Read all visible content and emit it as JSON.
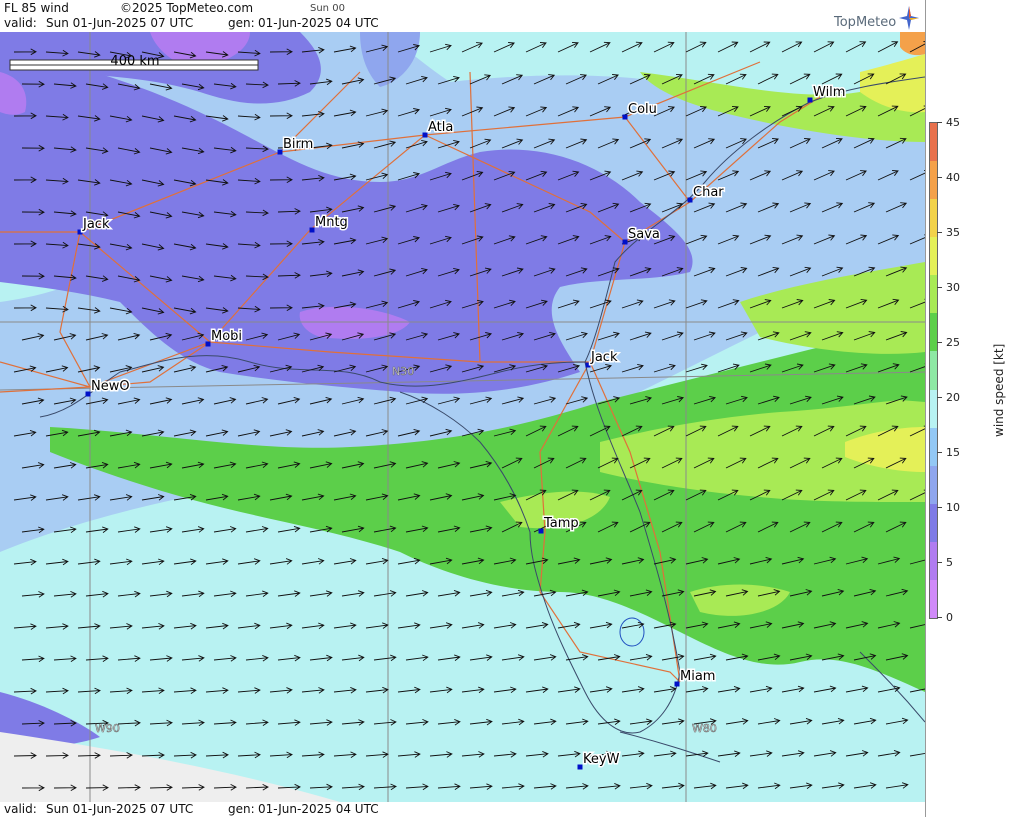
{
  "header": {
    "title": "FL 85 wind",
    "copyright": "©2025 TopMeteo.com",
    "run": "Sun 00",
    "valid_label": "valid:",
    "valid_value": "Sun  01-Jun-2025  07 UTC",
    "gen_label": "gen:",
    "gen_value": "01-Jun-2025 04 UTC"
  },
  "logo": {
    "text": "TopMeteo",
    "icon": "compass-star-icon"
  },
  "footer": {
    "valid_label": "valid:",
    "valid_value": "Sun  01-Jun-2025  07 UTC",
    "gen_label": "gen:",
    "gen_value": "01-Jun-2025 04 UTC"
  },
  "scale_bar": {
    "label": "400 km"
  },
  "grid_labels": {
    "lat_n30": "N30",
    "lon_w90": "W90",
    "lon_w80": "W80"
  },
  "colorbar": {
    "unit_label": "wind speed [kt]",
    "ticks": [
      "45",
      "40",
      "35",
      "30",
      "25",
      "20",
      "15",
      "10",
      "5",
      "0"
    ],
    "colors": [
      "#e8714d",
      "#f4a14a",
      "#f2d24a",
      "#e4f058",
      "#a8ea55",
      "#5ccf4a",
      "#8ee8a4",
      "#b8f2f2",
      "#93c8f5",
      "#8fa6ee",
      "#7f7be6",
      "#b07cf0",
      "#d08af8"
    ]
  },
  "cities": [
    {
      "name": "Birm"
    },
    {
      "name": "Atla"
    },
    {
      "name": "Colu"
    },
    {
      "name": "Wilm"
    },
    {
      "name": "Char"
    },
    {
      "name": "Sava"
    },
    {
      "name": "Jack"
    },
    {
      "name": "Mntg"
    },
    {
      "name": "Mobi"
    },
    {
      "name": "NewO"
    },
    {
      "name": "Jack"
    },
    {
      "name": "Tamp"
    },
    {
      "name": "Miam"
    },
    {
      "name": "KeyW"
    }
  ],
  "colors": {
    "background": "#a9cdf3",
    "grid": "#8a8a8a",
    "roads": "#e0703a",
    "coast": "#3a4a6a",
    "arrows": "#111111",
    "city_marker": "#0010c8",
    "land_outside": "#eeeeee"
  }
}
